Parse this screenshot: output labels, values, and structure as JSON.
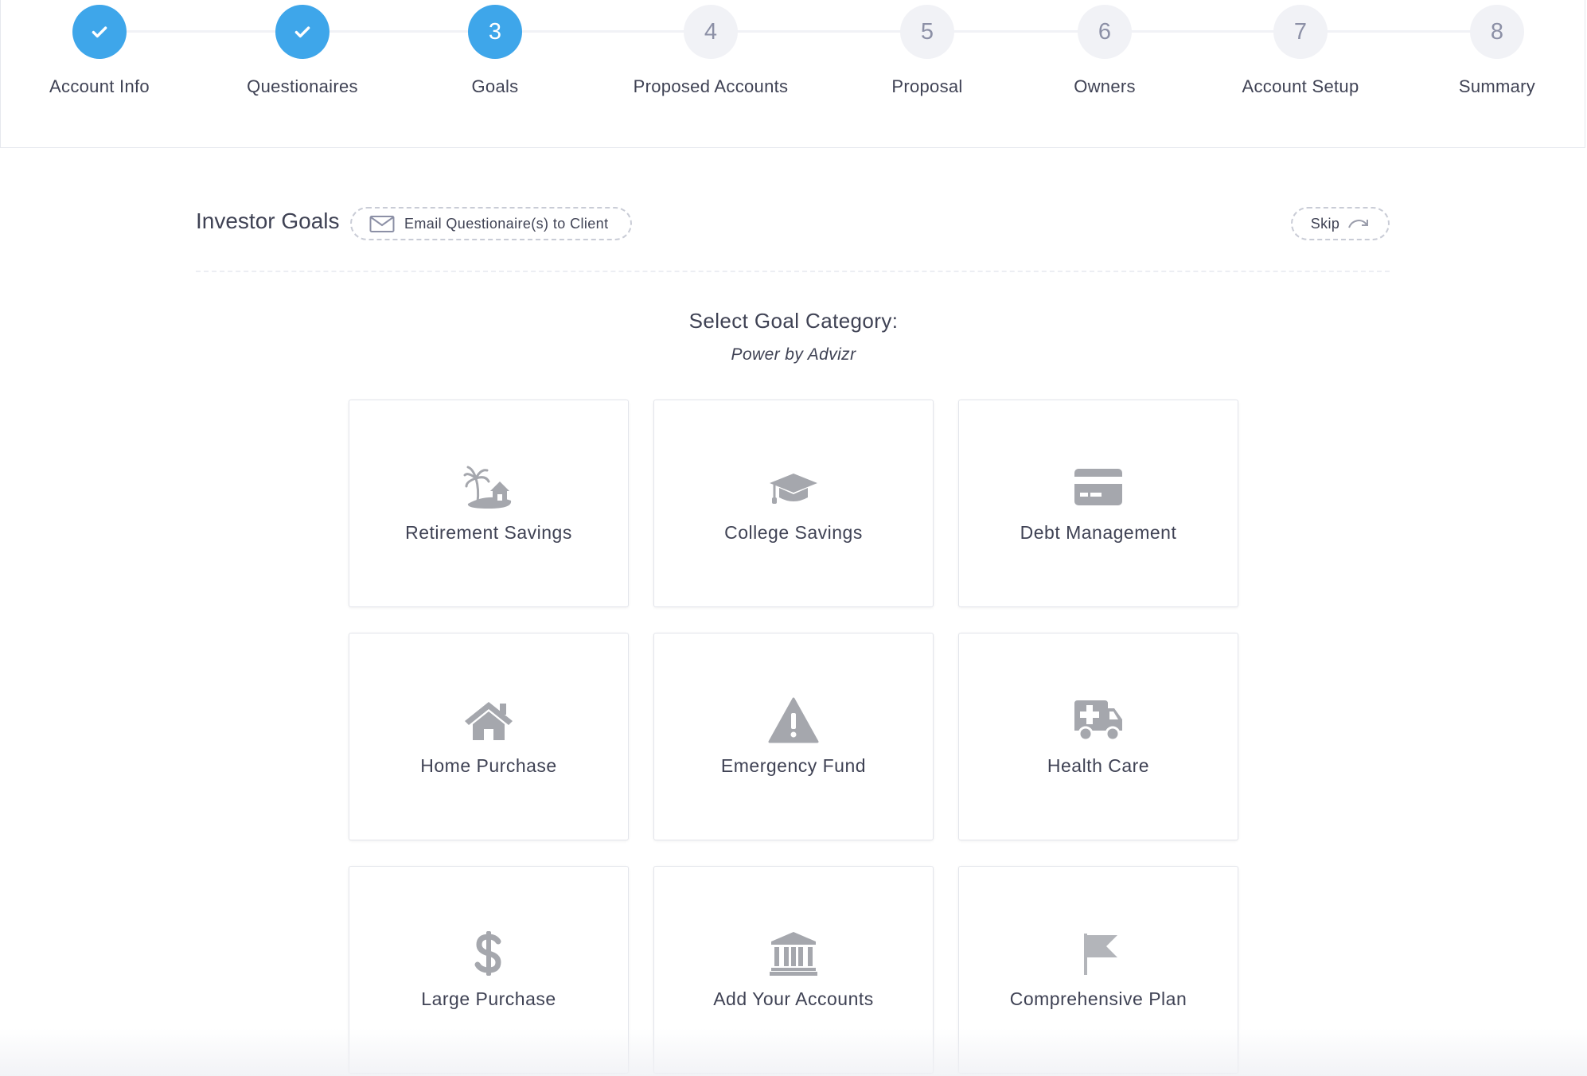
{
  "stepper": {
    "steps": [
      {
        "number": "1",
        "label": "Account Info",
        "state": "done"
      },
      {
        "number": "2",
        "label": "Questionaires",
        "state": "done"
      },
      {
        "number": "3",
        "label": "Goals",
        "state": "current"
      },
      {
        "number": "4",
        "label": "Proposed Accounts",
        "state": "pending"
      },
      {
        "number": "5",
        "label": "Proposal",
        "state": "pending"
      },
      {
        "number": "6",
        "label": "Owners",
        "state": "pending"
      },
      {
        "number": "7",
        "label": "Account Setup",
        "state": "pending"
      },
      {
        "number": "8",
        "label": "Summary",
        "state": "pending"
      }
    ]
  },
  "header": {
    "title": "Investor Goals",
    "email_button": "Email Questionaire(s) to Client",
    "skip_button": "Skip"
  },
  "section": {
    "title": "Select Goal Category:",
    "subtitle": "Power by Advizr"
  },
  "goals": [
    {
      "label": "Retirement Savings",
      "icon": "island-house-icon"
    },
    {
      "label": "College Savings",
      "icon": "graduation-cap-icon"
    },
    {
      "label": "Debt Management",
      "icon": "credit-card-icon"
    },
    {
      "label": "Home Purchase",
      "icon": "home-icon"
    },
    {
      "label": "Emergency Fund",
      "icon": "warning-icon"
    },
    {
      "label": "Health Care",
      "icon": "ambulance-icon"
    },
    {
      "label": "Large Purchase",
      "icon": "dollar-icon"
    },
    {
      "label": "Add Your Accounts",
      "icon": "bank-icon"
    },
    {
      "label": "Comprehensive Plan",
      "icon": "flag-icon"
    }
  ],
  "colors": {
    "accent": "#3ea6ea",
    "pending_circle": "#f1f2f6",
    "icon_gray": "#a5a7ad",
    "text": "#3f4254"
  }
}
